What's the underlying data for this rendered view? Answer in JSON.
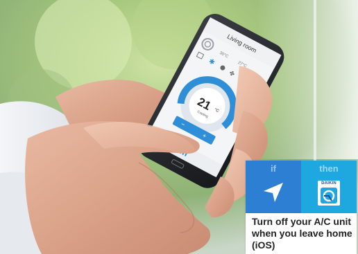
{
  "phone_screen": {
    "header_title": "Living room",
    "indoor_temp": "30°C",
    "outdoor_temp": "27°C",
    "power_state": "I",
    "set_temperature": "21",
    "temperature_unit": "°C",
    "mode_label": "Cooling",
    "minus_label": "−",
    "plus_label": "+"
  },
  "recipe_card": {
    "if_label": "if",
    "then_label": "then",
    "trigger_icon": "location-arrow-icon",
    "action_logo_text": "DAIKIN",
    "title": "Turn off your A/C unit when you leave home (iOS)",
    "colors": {
      "if_background": "#2d7fd3",
      "then_background": "#1fa7df",
      "power_on_green": "#3cb54a",
      "dial_blue": "#2e8fd8"
    }
  }
}
